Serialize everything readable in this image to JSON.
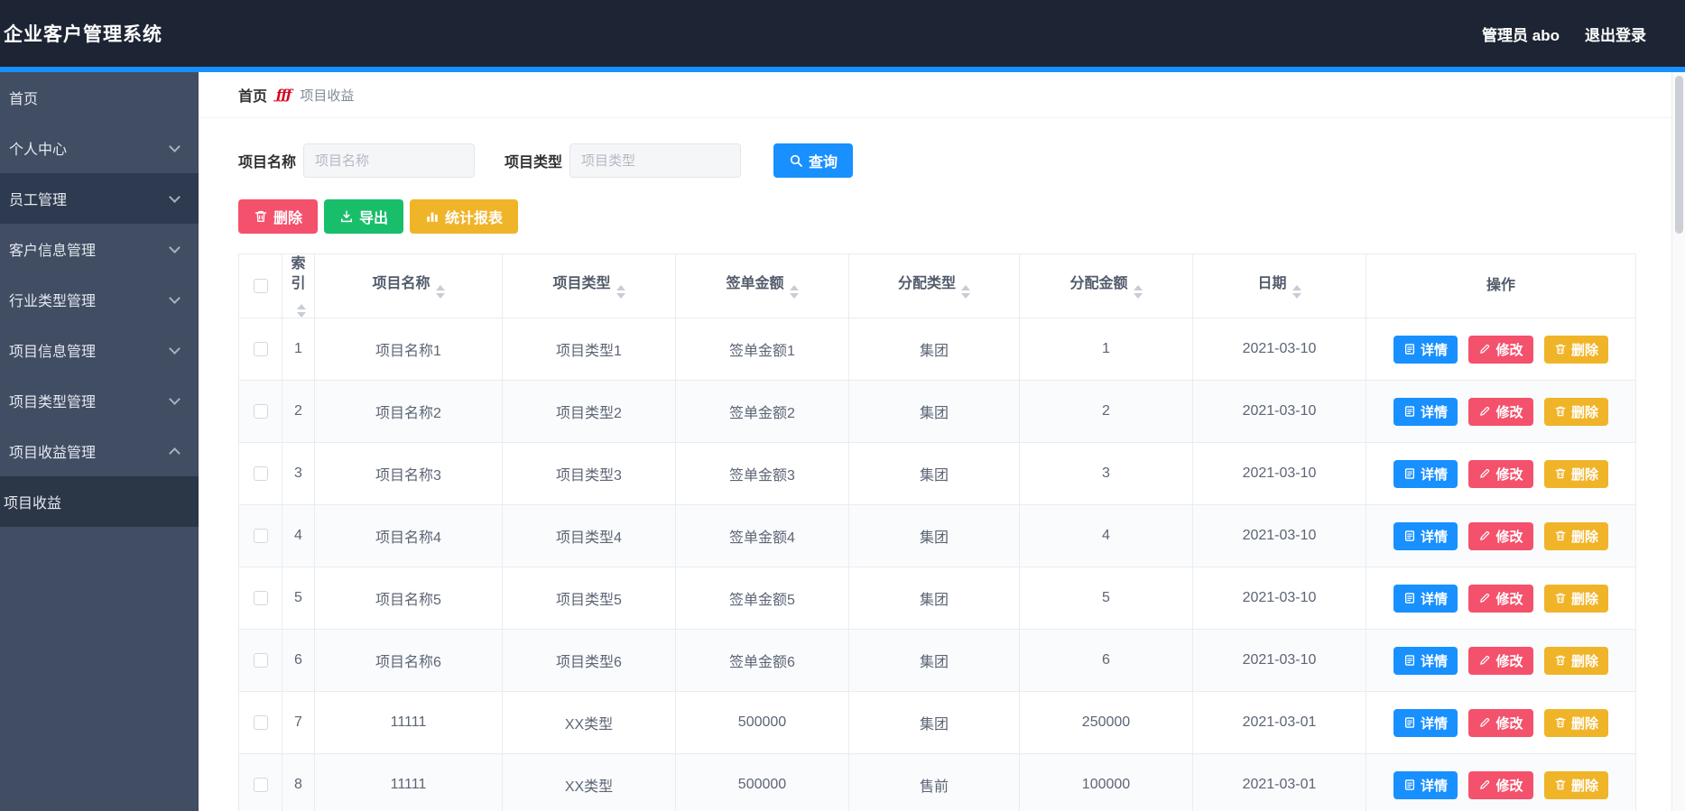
{
  "topbar": {
    "title": "企业客户管理系统",
    "user": "管理员 abo",
    "logout": "退出登录"
  },
  "sidebar": {
    "items": [
      {
        "label": "首页",
        "chevron": "none",
        "active": false,
        "submenu": false
      },
      {
        "label": "个人中心",
        "chevron": "down",
        "active": false,
        "submenu": false
      },
      {
        "label": "员工管理",
        "chevron": "down",
        "active": true,
        "submenu": false
      },
      {
        "label": "客户信息管理",
        "chevron": "down",
        "active": false,
        "submenu": false
      },
      {
        "label": "行业类型管理",
        "chevron": "down",
        "active": false,
        "submenu": false
      },
      {
        "label": "项目信息管理",
        "chevron": "down",
        "active": false,
        "submenu": false
      },
      {
        "label": "项目类型管理",
        "chevron": "down",
        "active": false,
        "submenu": false
      },
      {
        "label": "项目收益管理",
        "chevron": "up",
        "active": false,
        "submenu": false
      },
      {
        "label": "项目收益",
        "chevron": "none",
        "active": false,
        "submenu": true
      }
    ]
  },
  "breadcrumb": {
    "home": "首页",
    "separator": "ƒƒƒ",
    "current": "项目收益"
  },
  "filters": {
    "name_label": "项目名称",
    "name_placeholder": "项目名称",
    "type_label": "项目类型",
    "type_placeholder": "项目类型",
    "query_button": "查询"
  },
  "toolbar": {
    "delete_button": "删除",
    "export_button": "导出",
    "report_button": "统计报表"
  },
  "table": {
    "headers": [
      "索引",
      "项目名称",
      "项目类型",
      "签单金额",
      "分配类型",
      "分配金额",
      "日期",
      "操作"
    ],
    "row_actions": {
      "detail": "详情",
      "edit": "修改",
      "delete": "删除"
    },
    "rows": [
      {
        "index": "1",
        "name": "项目名称1",
        "type": "项目类型1",
        "amount": "签单金额1",
        "alloc_type": "集团",
        "alloc_amount": "1",
        "date": "2021-03-10"
      },
      {
        "index": "2",
        "name": "项目名称2",
        "type": "项目类型2",
        "amount": "签单金额2",
        "alloc_type": "集团",
        "alloc_amount": "2",
        "date": "2021-03-10"
      },
      {
        "index": "3",
        "name": "项目名称3",
        "type": "项目类型3",
        "amount": "签单金额3",
        "alloc_type": "集团",
        "alloc_amount": "3",
        "date": "2021-03-10"
      },
      {
        "index": "4",
        "name": "项目名称4",
        "type": "项目类型4",
        "amount": "签单金额4",
        "alloc_type": "集团",
        "alloc_amount": "4",
        "date": "2021-03-10"
      },
      {
        "index": "5",
        "name": "项目名称5",
        "type": "项目类型5",
        "amount": "签单金额5",
        "alloc_type": "集团",
        "alloc_amount": "5",
        "date": "2021-03-10"
      },
      {
        "index": "6",
        "name": "项目名称6",
        "type": "项目类型6",
        "amount": "签单金额6",
        "alloc_type": "集团",
        "alloc_amount": "6",
        "date": "2021-03-10"
      },
      {
        "index": "7",
        "name": "11111",
        "type": "XX类型",
        "amount": "500000",
        "alloc_type": "集团",
        "alloc_amount": "250000",
        "date": "2021-03-01"
      },
      {
        "index": "8",
        "name": "11111",
        "type": "XX类型",
        "amount": "500000",
        "alloc_type": "售前",
        "alloc_amount": "100000",
        "date": "2021-03-01"
      }
    ]
  },
  "colors": {
    "primary": "#1890ff",
    "danger": "#f4516c",
    "success": "#19be6b",
    "warning": "#f0b429",
    "topbar_bg": "#1d2433",
    "sidebar_bg": "#404d63",
    "breadcrumb_icon": "#d9001b"
  }
}
